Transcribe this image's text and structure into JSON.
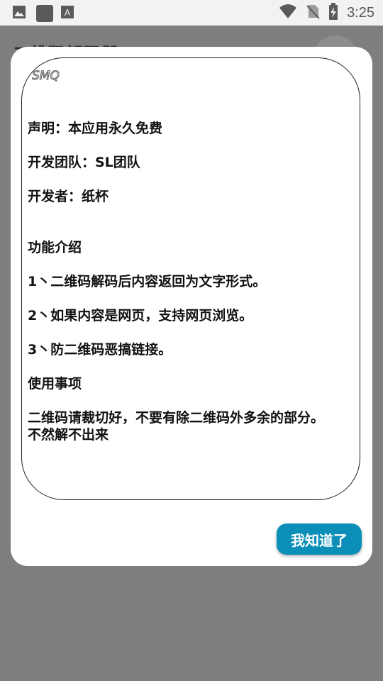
{
  "status_bar": {
    "time": "3:25",
    "icons_left": [
      "gallery-icon",
      "square-app-icon",
      "text-app-icon"
    ],
    "icons_right": [
      "wifi-icon",
      "no-sim-icon",
      "battery-icon"
    ]
  },
  "app": {
    "title": "二维码解码器"
  },
  "dialog": {
    "logo_text": "SMQ",
    "lines": [
      "声明：本应用永久免费",
      "开发团队：SL团队",
      "开发者：纸杯",
      "功能介绍",
      "1丶二维码解码后内容返回为文字形式。",
      "2丶如果内容是网页，支持网页浏览。",
      "3丶防二维码恶搞链接。",
      "使用事项",
      "二维码请裁切好，不要有除二维码外多余的部分。",
      "不然解不出来"
    ],
    "confirm_button": "我知道了"
  },
  "colors": {
    "accent": "#0b8eb8",
    "scrim": "#7f7f7f"
  }
}
